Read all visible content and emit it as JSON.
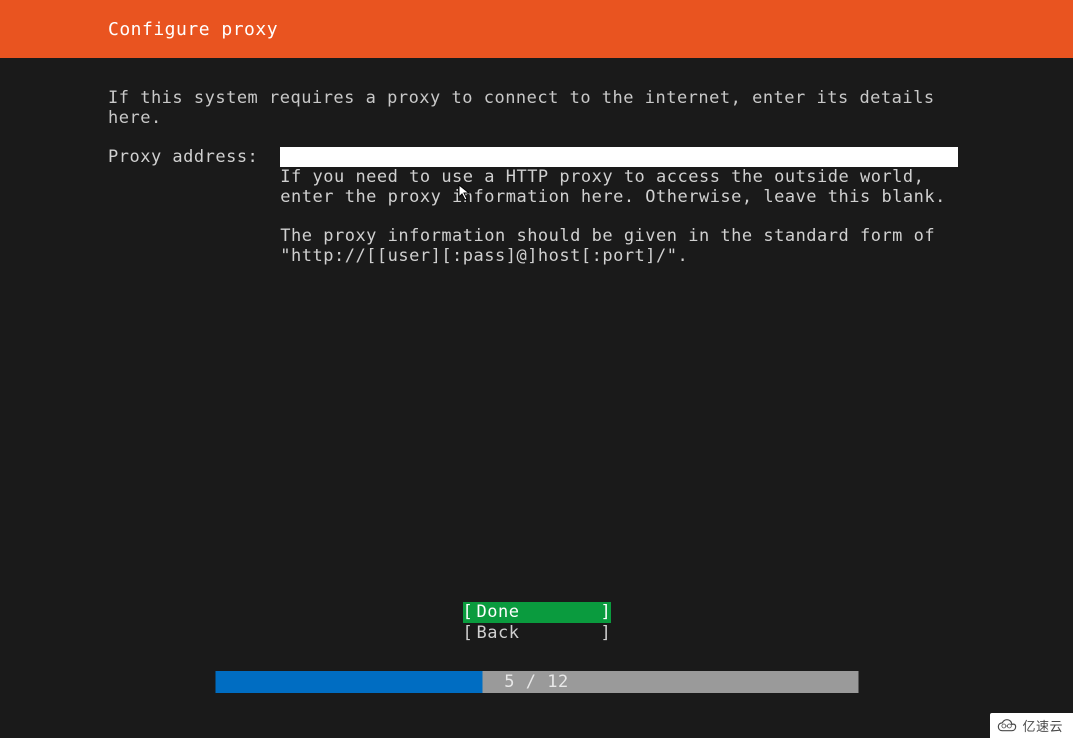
{
  "header": {
    "title": "Configure proxy"
  },
  "instruction": "If this system requires a proxy to connect to the internet, enter its details\nhere.",
  "proxy": {
    "label": "Proxy address:",
    "value": "",
    "help1": "If you need to use a HTTP proxy to access the outside world,\nenter the proxy information here. Otherwise, leave this blank.",
    "help2": "The proxy information should be given in the standard form of\n\"http://[[user][:pass]@]host[:port]/\"."
  },
  "buttons": {
    "done": "Done",
    "back": "Back",
    "bracket_l": "[",
    "bracket_r": "]"
  },
  "progress": {
    "text": "5 / 12",
    "current": 5,
    "total": 12,
    "percent": 41.67
  },
  "watermark": {
    "text": "亿速云"
  }
}
